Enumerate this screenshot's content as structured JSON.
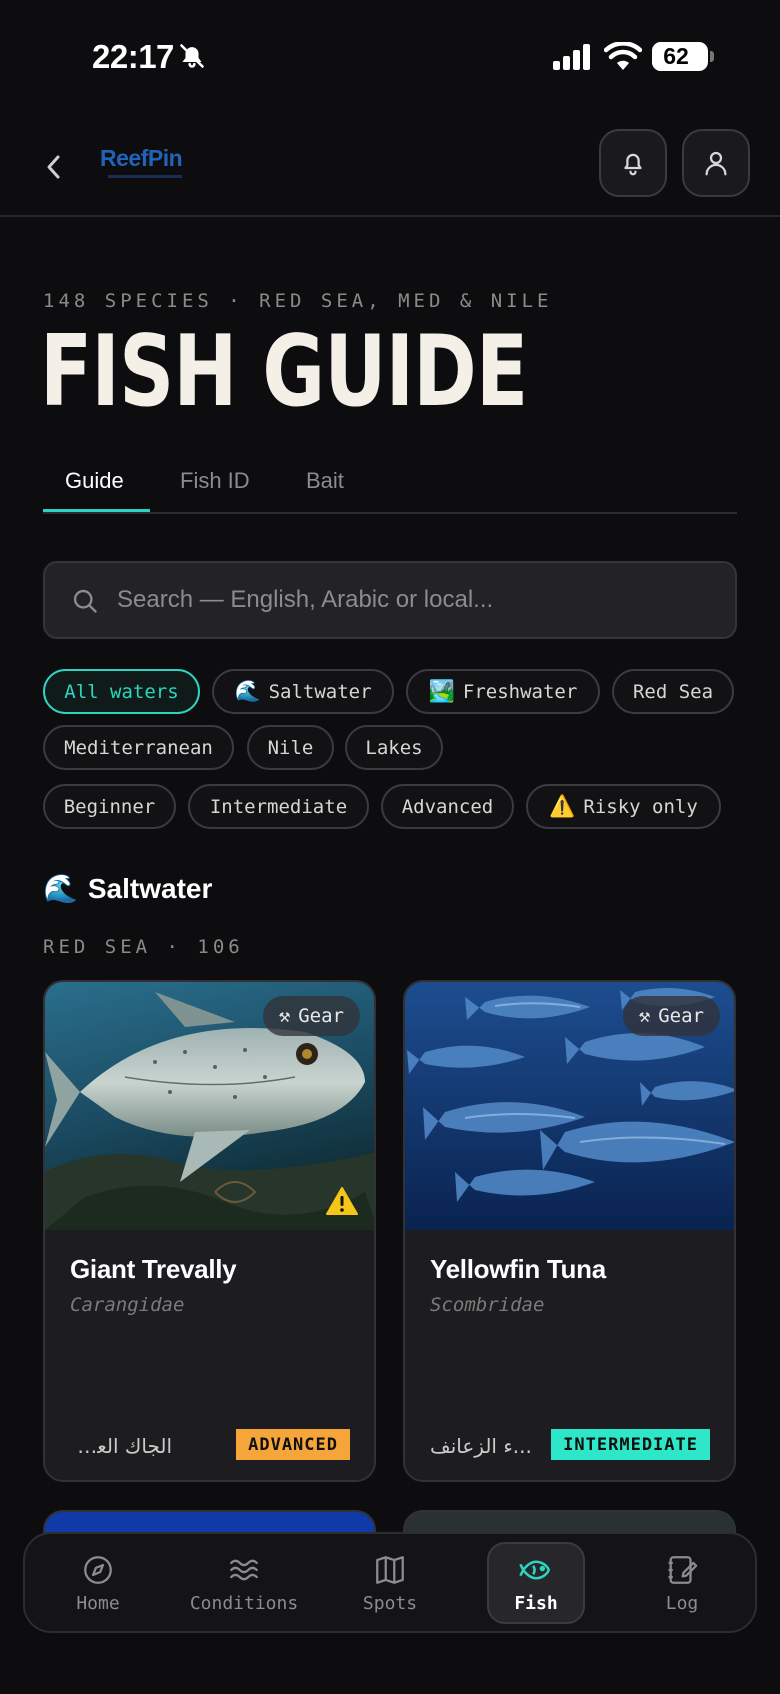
{
  "status_bar": {
    "time": "22:17",
    "battery": "62"
  },
  "header": {
    "logo_text": "ReefPin",
    "back_icon": "chevron-left-icon",
    "bell_icon": "bell-icon",
    "profile_icon": "user-icon"
  },
  "hero": {
    "eyebrow": "148 SPECIES · RED SEA, MED & NILE",
    "title": "FISH GUIDE"
  },
  "tabs": [
    {
      "label": "Guide",
      "active": true
    },
    {
      "label": "Fish ID",
      "active": false
    },
    {
      "label": "Bait",
      "active": false
    }
  ],
  "search": {
    "placeholder": "Search — English, Arabic or local...",
    "value": ""
  },
  "water_filters": [
    {
      "label": "All waters",
      "emoji": "",
      "active": true
    },
    {
      "label": "Saltwater",
      "emoji": "🌊",
      "active": false
    },
    {
      "label": "Freshwater",
      "emoji": "🏞️",
      "active": false
    },
    {
      "label": "Red Sea",
      "emoji": "",
      "active": false
    },
    {
      "label": "Mediterranean",
      "emoji": "",
      "active": false
    },
    {
      "label": "Nile",
      "emoji": "",
      "active": false
    },
    {
      "label": "Lakes",
      "emoji": "",
      "active": false
    }
  ],
  "level_filters": [
    {
      "label": "Beginner",
      "emoji": ""
    },
    {
      "label": "Intermediate",
      "emoji": ""
    },
    {
      "label": "Advanced",
      "emoji": ""
    },
    {
      "label": "Risky only",
      "emoji": "⚠️"
    }
  ],
  "section": {
    "emoji": "🌊",
    "title": "Saltwater",
    "subtitle": "RED SEA · 106"
  },
  "cards": [
    {
      "name": "Giant Trevally",
      "family": "Carangidae",
      "local_name": "الجاك العملاق",
      "level": "ADVANCED",
      "level_color": "#f5a53a",
      "gear_label": "Gear",
      "risky": true
    },
    {
      "name": "Yellowfin Tuna",
      "family": "Scombridae",
      "local_name": "...ء الزعانف",
      "level": "INTERMEDIATE",
      "level_color": "#2ee6c8",
      "gear_label": "Gear",
      "risky": false
    }
  ],
  "bottom_nav": [
    {
      "label": "Home",
      "icon": "compass-icon",
      "active": false
    },
    {
      "label": "Conditions",
      "icon": "waves-icon",
      "active": false
    },
    {
      "label": "Spots",
      "icon": "map-icon",
      "active": false
    },
    {
      "label": "Fish",
      "icon": "fish-icon",
      "active": true
    },
    {
      "label": "Log",
      "icon": "notebook-icon",
      "active": false
    }
  ]
}
